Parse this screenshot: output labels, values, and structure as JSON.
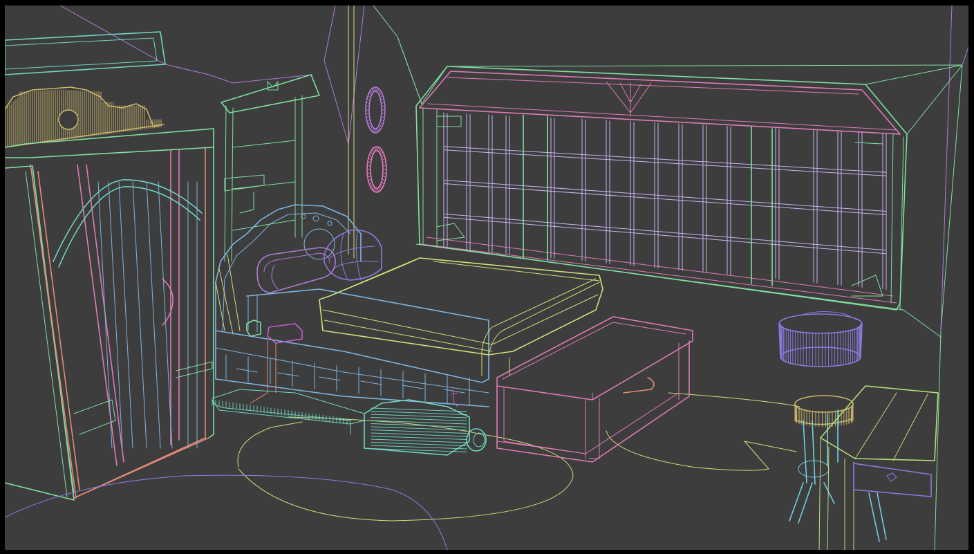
{
  "viewport": {
    "mode": "wireframe",
    "background": "#3d3d3d",
    "frame_color": "#000000"
  },
  "palette": {
    "green": "#7fe0a0",
    "teal": "#6fd7c2",
    "purple": "#b07ad6",
    "pink": "#e07ab8",
    "lavender": "#c9b4f0",
    "blue": "#7fb4e0",
    "yellow": "#d4de7a",
    "gold": "#cdb86b",
    "salmon": "#e58a78",
    "violet": "#8c7ae0",
    "cyan": "#6fd0e0",
    "lime": "#b6e07a",
    "magenta": "#c45fd0"
  },
  "scene_objects": [
    {
      "name": "wardrobe",
      "color": "green"
    },
    {
      "name": "wardrobe-door",
      "color": "pink"
    },
    {
      "name": "decorative-crest",
      "color": "gold"
    },
    {
      "name": "shelf-window",
      "color": "green"
    },
    {
      "name": "wall-rings",
      "color": "purple"
    },
    {
      "name": "big-window",
      "color": "lavender"
    },
    {
      "name": "bed",
      "color": "yellow"
    },
    {
      "name": "headboard",
      "color": "blue"
    },
    {
      "name": "pillow-left",
      "color": "purple"
    },
    {
      "name": "pillow-right",
      "color": "violet"
    },
    {
      "name": "chest",
      "color": "pink"
    },
    {
      "name": "basket",
      "color": "violet"
    },
    {
      "name": "stool",
      "color": "cyan"
    },
    {
      "name": "desk",
      "color": "lime"
    },
    {
      "name": "rug",
      "color": "yellow"
    },
    {
      "name": "roll-object",
      "color": "teal"
    }
  ]
}
